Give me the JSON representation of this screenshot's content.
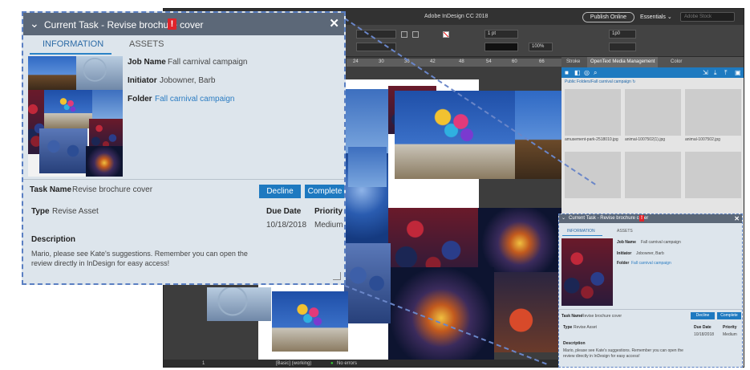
{
  "app": {
    "title": "Adobe InDesign CC 2018",
    "publish_label": "Publish Online",
    "workspace": "Essentials",
    "search_placeholder": "Adobe Stock",
    "stroke_weight": "1 pt",
    "zoom": "100%",
    "opacity": "1p0",
    "ruler_marks": [
      "24",
      "30",
      "36",
      "42",
      "48",
      "54",
      "60",
      "66"
    ],
    "status": {
      "page": "1",
      "style": "[Basic] (working)",
      "errors": "No errors"
    }
  },
  "right_panel": {
    "tabs": [
      "Stroke",
      "OpenText Media Management",
      "Color"
    ],
    "breadcrumb": "Public Folders/Fall carnival campaign",
    "thumbs": [
      {
        "caption": "amusement-park-2518010.jpg"
      },
      {
        "caption": "animal-1007502(1).jpg"
      },
      {
        "caption": "animal-1007502.jpg"
      }
    ]
  },
  "task": {
    "title": "Current Task - Revise brochure cover",
    "tabs": {
      "information": "INFORMATION",
      "assets": "ASSETS"
    },
    "job_name_label": "Job Name",
    "job_name": "Fall carnival campaign",
    "initiator_label": "Initiator",
    "initiator": "Jobowner, Barb",
    "folder_label": "Folder",
    "folder": "Fall carnival campaign",
    "task_name_label": "Task Name",
    "task_name": "Revise brochure cover",
    "decline_label": "Decline",
    "complete_label": "Complete",
    "type_label": "Type",
    "type": "Revise Asset",
    "due_date_label": "Due Date",
    "due_date": "10/18/2018",
    "priority_label": "Priority",
    "priority": "Medium",
    "description_label": "Description",
    "description": "Mario, please see Kate's suggestions. Remember you can open the review directly in InDesign for easy access!",
    "warning_glyph": "!",
    "close_glyph": "✕"
  },
  "colors": {
    "accent": "#1e79c0",
    "panel_bg": "#dde5ec",
    "header_bg": "#5c6878",
    "warning": "#e0242b"
  }
}
